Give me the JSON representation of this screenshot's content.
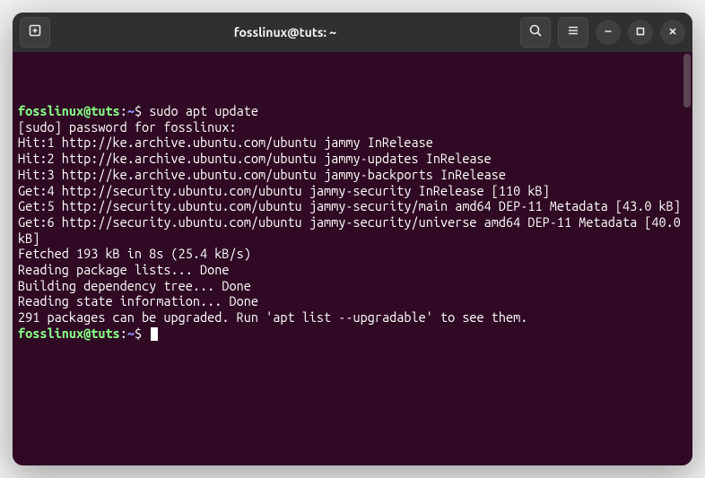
{
  "window": {
    "title": "fosslinux@tuts: ~"
  },
  "prompt": {
    "user_host": "fosslinux@tuts",
    "sep": ":",
    "path": "~",
    "dollar": "$"
  },
  "command": "sudo apt update",
  "output": [
    "[sudo] password for fosslinux: ",
    "Hit:1 http://ke.archive.ubuntu.com/ubuntu jammy InRelease",
    "Hit:2 http://ke.archive.ubuntu.com/ubuntu jammy-updates InRelease",
    "Hit:3 http://ke.archive.ubuntu.com/ubuntu jammy-backports InRelease",
    "Get:4 http://security.ubuntu.com/ubuntu jammy-security InRelease [110 kB]",
    "Get:5 http://security.ubuntu.com/ubuntu jammy-security/main amd64 DEP-11 Metadata [43.0 kB]",
    "Get:6 http://security.ubuntu.com/ubuntu jammy-security/universe amd64 DEP-11 Metadata [40.0 kB]",
    "Fetched 193 kB in 8s (25.4 kB/s)",
    "Reading package lists... Done",
    "Building dependency tree... Done",
    "Reading state information... Done",
    "291 packages can be upgraded. Run 'apt list --upgradable' to see them."
  ],
  "icons": {
    "new_tab": "new-tab-icon",
    "search": "search-icon",
    "menu": "hamburger-menu-icon",
    "minimize": "minimize-icon",
    "maximize": "maximize-icon",
    "close": "close-icon"
  }
}
